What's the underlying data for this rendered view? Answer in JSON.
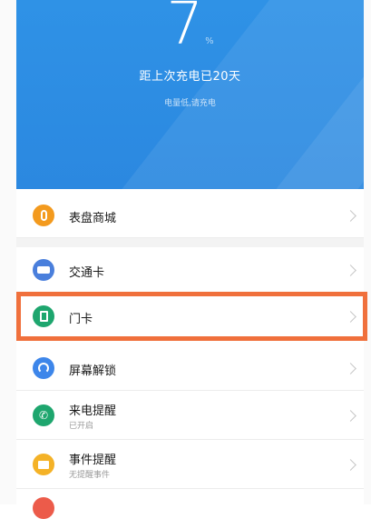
{
  "header": {
    "battery_value": "7",
    "battery_unit": "%",
    "charge_title": "距上次充电已20天",
    "charge_sub": "电量低,请充电"
  },
  "menu": [
    {
      "label": "表盘商城",
      "icon": "watch-icon",
      "color": "#f39a1e"
    },
    {
      "label": "交通卡",
      "icon": "bus-card-icon",
      "color": "#4a7fdc"
    },
    {
      "label": "门卡",
      "icon": "door-card-icon",
      "color": "#1ea66e"
    },
    {
      "label": "屏幕解锁",
      "icon": "unlock-icon",
      "color": "#3d86ea"
    },
    {
      "label": "来电提醒",
      "sublabel": "已开启",
      "icon": "phone-icon",
      "color": "#1ea66e"
    },
    {
      "label": "事件提醒",
      "sublabel": "无提醒事件",
      "icon": "event-icon",
      "color": "#f4b227"
    },
    {
      "label": "",
      "icon": "alarm-icon",
      "color": "#ec5b4a"
    }
  ],
  "colors": {
    "header": "#2b88e0",
    "highlight": "#f0703c"
  }
}
